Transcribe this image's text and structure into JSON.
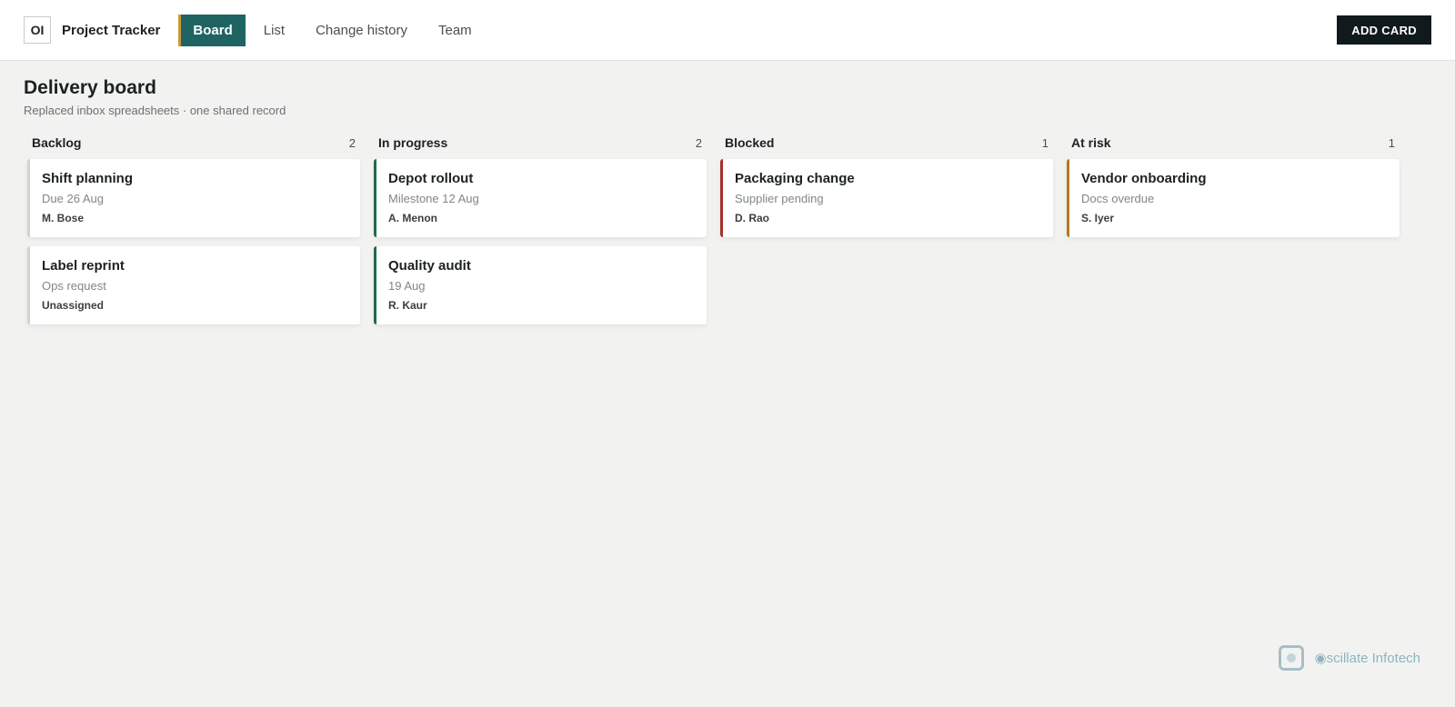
{
  "header": {
    "logo_text": "OI",
    "app_title": "Project Tracker",
    "tabs": [
      {
        "label": "Board",
        "active": true
      },
      {
        "label": "List",
        "active": false
      },
      {
        "label": "Change history",
        "active": false
      },
      {
        "label": "Team",
        "active": false
      }
    ],
    "add_button_label": "ADD CARD"
  },
  "page": {
    "title": "Delivery board",
    "subtitle": "Replaced inbox spreadsheets · one shared record"
  },
  "columns": [
    {
      "title": "Backlog",
      "count": "2",
      "accent": "#d0d3d2",
      "cards": [
        {
          "title": "Shift planning",
          "meta": "Due 26 Aug",
          "owner": "M. Bose"
        },
        {
          "title": "Label reprint",
          "meta": "Ops request",
          "owner": "Unassigned"
        }
      ]
    },
    {
      "title": "In progress",
      "count": "2",
      "accent": "#1e6b4a",
      "cards": [
        {
          "title": "Depot rollout",
          "meta": "Milestone 12 Aug",
          "owner": "A. Menon"
        },
        {
          "title": "Quality audit",
          "meta": "19 Aug",
          "owner": "R. Kaur"
        }
      ]
    },
    {
      "title": "Blocked",
      "count": "1",
      "accent": "#a8302c",
      "cards": [
        {
          "title": "Packaging change",
          "meta": "Supplier pending",
          "owner": "D. Rao"
        }
      ]
    },
    {
      "title": "At risk",
      "count": "1",
      "accent": "#b07a1e",
      "cards": [
        {
          "title": "Vendor onboarding",
          "meta": "Docs overdue",
          "owner": "S. Iyer"
        }
      ]
    }
  ],
  "watermark": {
    "text": "scillate Infotech",
    "icon": "oscillate-logo-icon"
  },
  "colors": {
    "active_tab": "#1f6462",
    "active_tab_marker": "#c79a3a",
    "add_button": "#10191c",
    "background": "#f2f3f1"
  }
}
